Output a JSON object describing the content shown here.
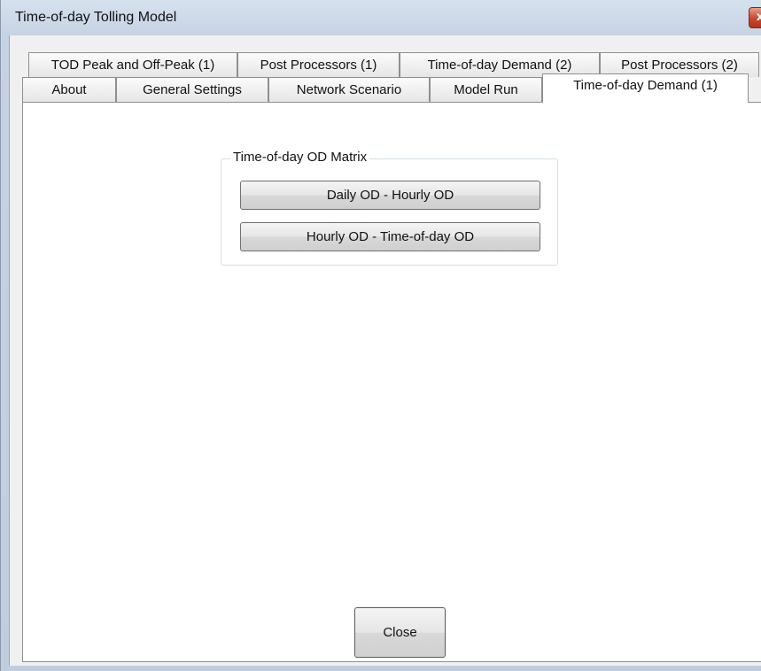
{
  "window": {
    "title": "Time-of-day Tolling Model",
    "close_glyph": "x"
  },
  "tabs_row_back": [
    "TOD Peak and Off-Peak (1)",
    "Post Processors (1)",
    "Time-of-day Demand (2)",
    "Post Processors (2)"
  ],
  "tabs_row_front": [
    "About",
    "General Settings",
    "Network Scenario",
    "Model Run",
    "Time-of-day Demand (1)"
  ],
  "active_tab": "Time-of-day Demand (1)",
  "group": {
    "title": "Time-of-day OD Matrix",
    "buttons": [
      "Daily OD - Hourly OD",
      "Hourly OD - Time-of-day OD"
    ]
  },
  "footer": {
    "close_label": "Close"
  }
}
